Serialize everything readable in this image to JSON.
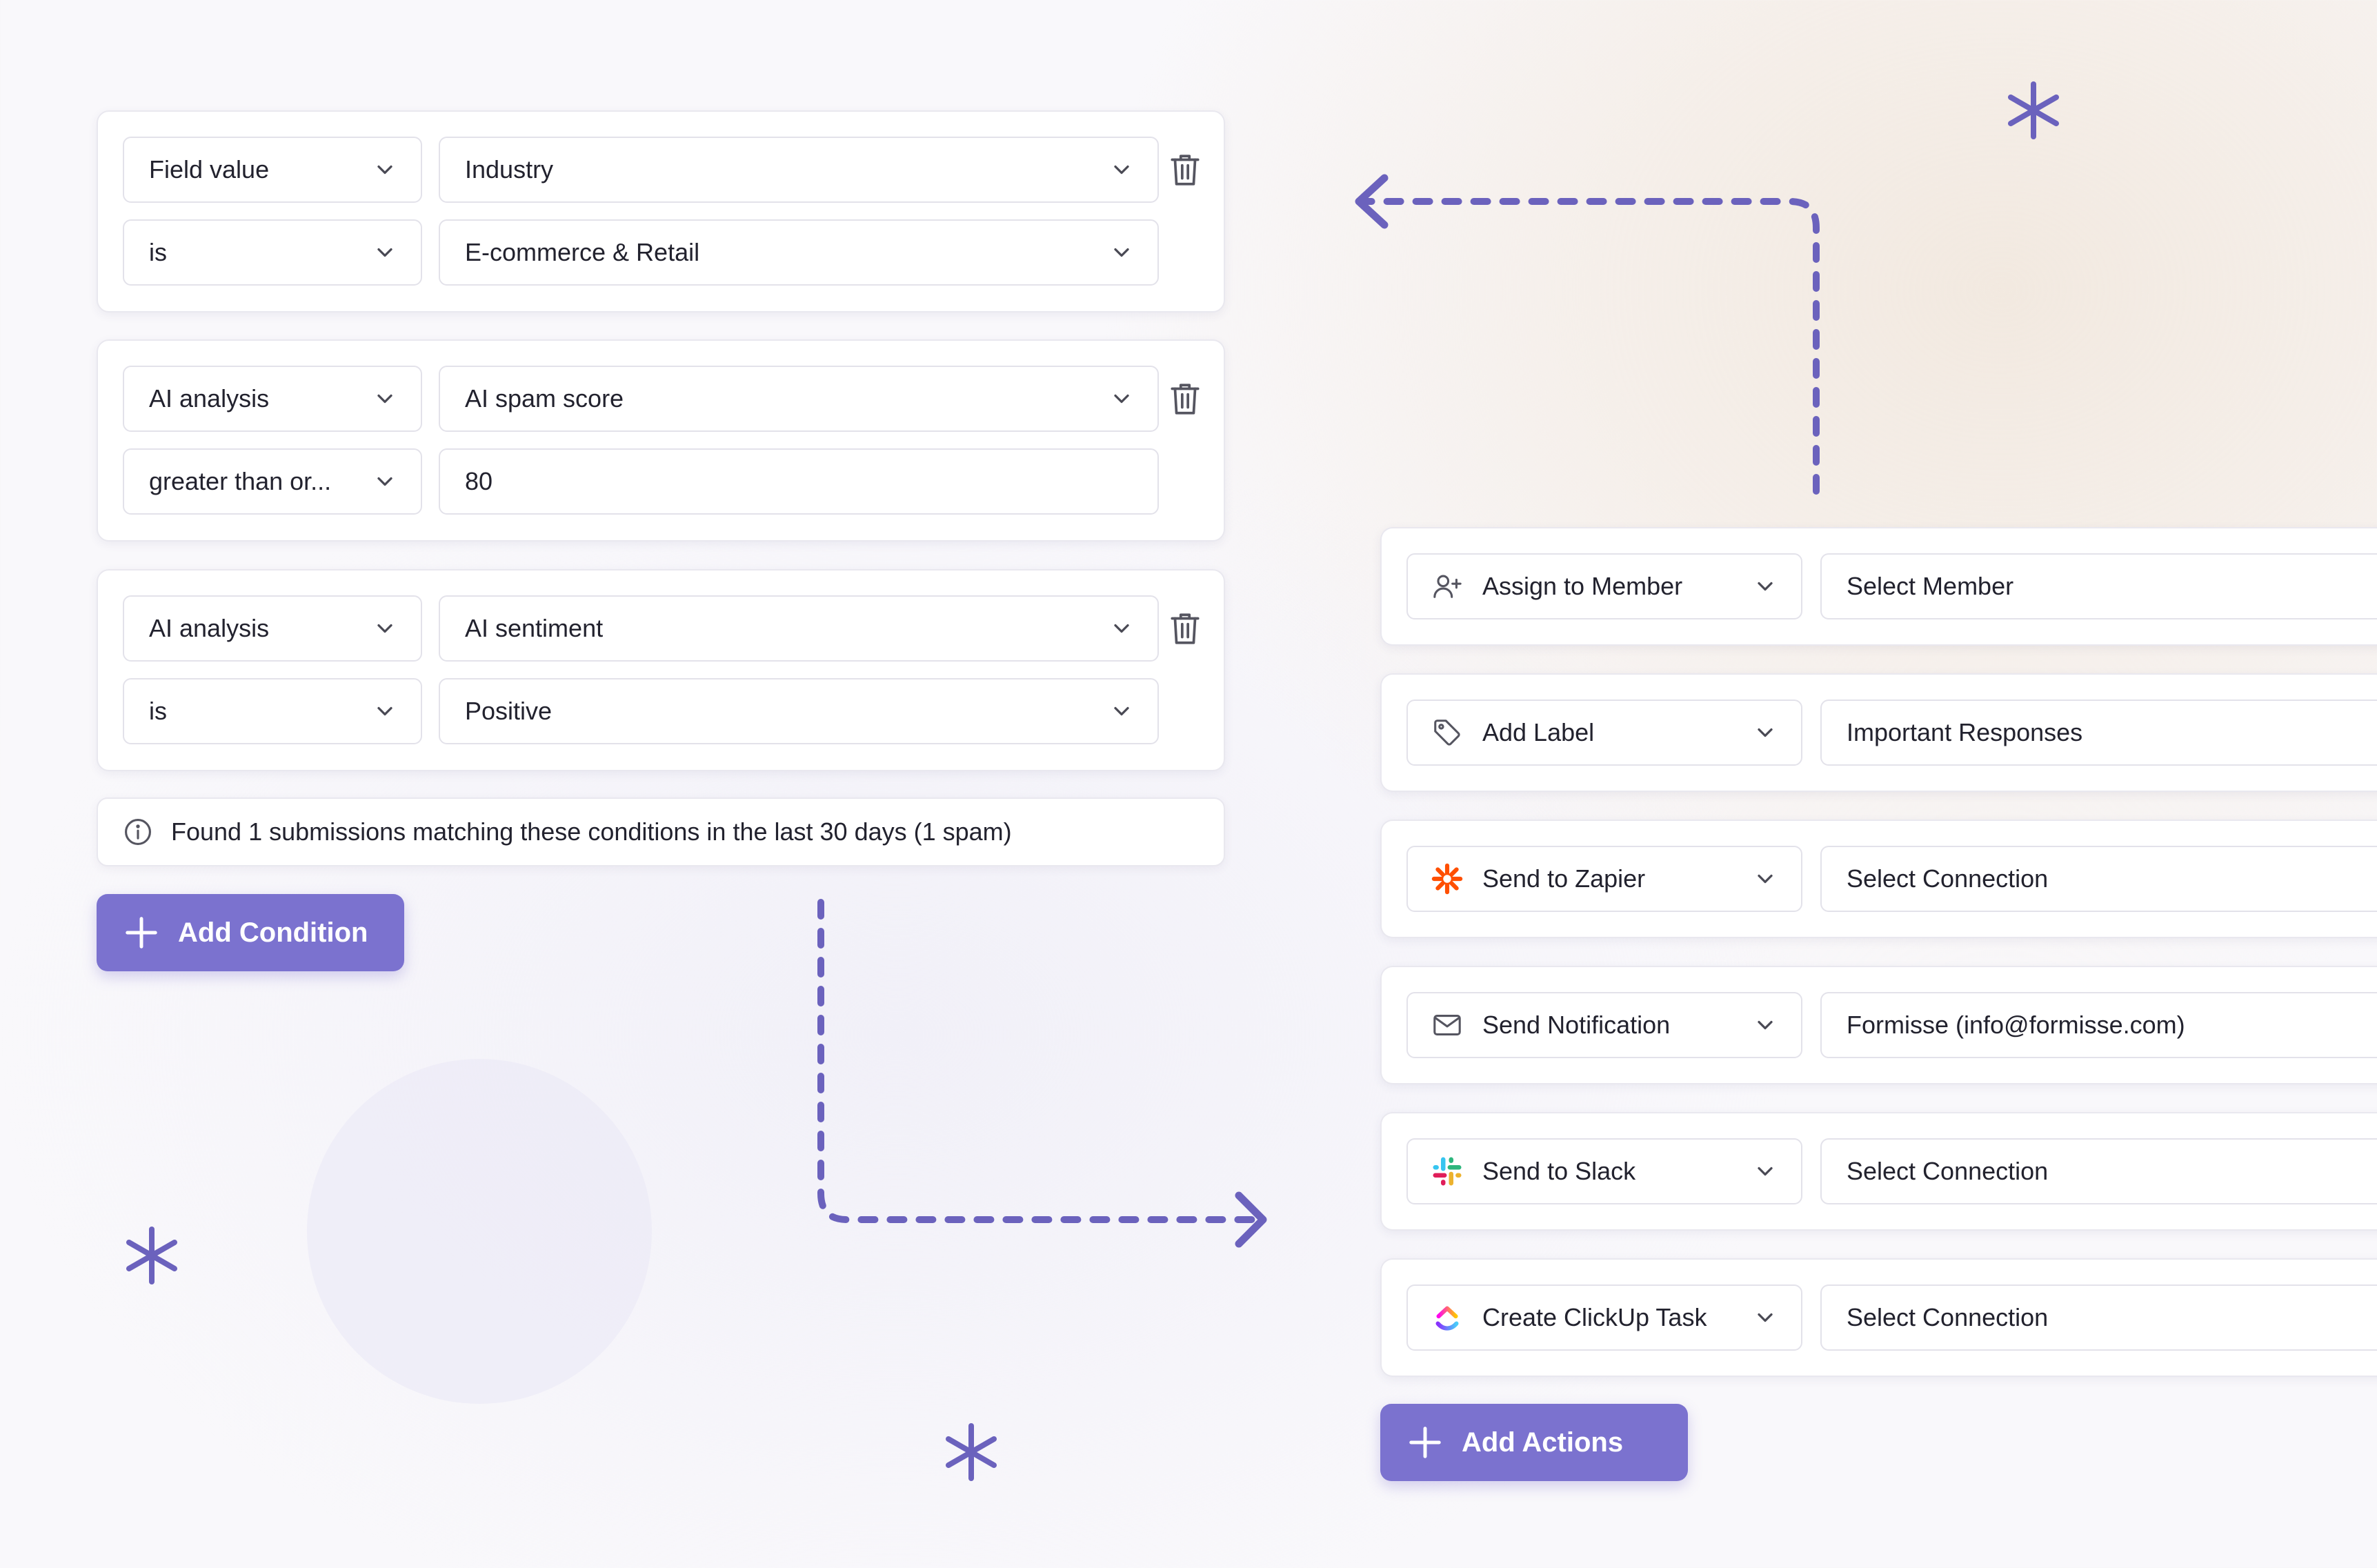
{
  "conditions": [
    {
      "field_type": "Field value",
      "field": "Industry",
      "operator": "is",
      "value": "E-commerce & Retail"
    },
    {
      "field_type": "AI analysis",
      "field": "AI spam score",
      "operator": "greater than or...",
      "value": "80"
    },
    {
      "field_type": "AI analysis",
      "field": "AI sentiment",
      "operator": "is",
      "value": "Positive"
    }
  ],
  "info": {
    "message": "Found 1 submissions matching these conditions in the last 30 days (1 spam)"
  },
  "add_condition_label": "Add Condition",
  "actions": [
    {
      "icon": "user-plus-icon",
      "label": "Assign to Member",
      "value": "Select Member"
    },
    {
      "icon": "tag-icon",
      "label": "Add Label",
      "value": "Important Responses"
    },
    {
      "icon": "zapier-icon",
      "label": "Send to Zapier",
      "value": "Select Connection"
    },
    {
      "icon": "mail-icon",
      "label": "Send Notification",
      "value": "Formisse (info@formisse.com)"
    },
    {
      "icon": "slack-icon",
      "label": "Send to Slack",
      "value": "Select Connection"
    },
    {
      "icon": "clickup-icon",
      "label": "Create ClickUp Task",
      "value": "Select Connection"
    }
  ],
  "add_actions_label": "Add Actions",
  "colors": {
    "accent": "#7b72cf",
    "connector": "#6b62bd",
    "zapier": "#ff4f00"
  }
}
